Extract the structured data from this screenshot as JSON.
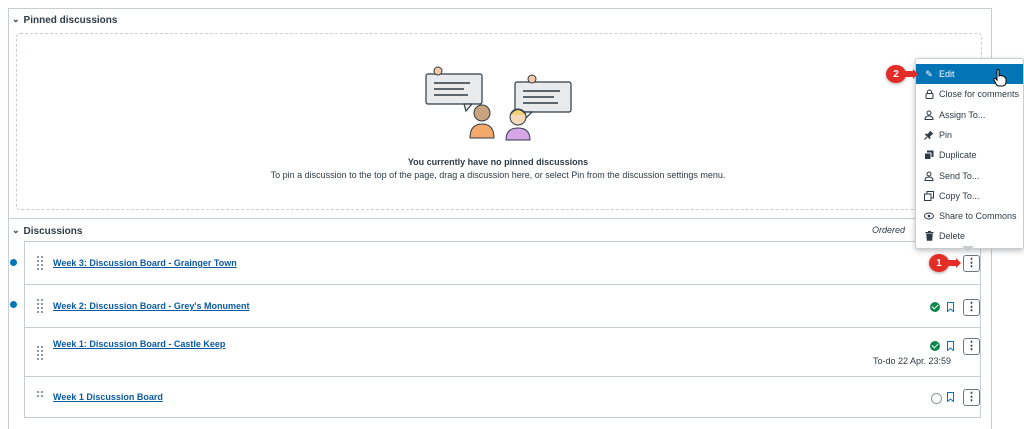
{
  "pinned": {
    "heading": "Pinned discussions",
    "empty_title": "You currently have no pinned discussions",
    "empty_sub": "To pin a discussion to the top of the page, drag a discussion here, or select Pin from the discussion settings menu."
  },
  "discussions": {
    "heading": "Discussions",
    "ordered_label": "Ordered",
    "rows": [
      {
        "title": "Week 3: Discussion Board - Grainger Town",
        "unread": true
      },
      {
        "title": "Week 2: Discussion Board - Grey's Monument",
        "unread": true,
        "published": true
      },
      {
        "title": "Week 1: Discussion Board - Castle Keep",
        "unread": false,
        "published": true,
        "todo": "To-do 22 Apr. 23:59"
      },
      {
        "title": "Week 1 Discussion Board",
        "unread": false
      }
    ]
  },
  "menu": {
    "items": [
      {
        "label": "Edit",
        "icon": "pencil-icon"
      },
      {
        "label": "Close for comments",
        "icon": "lock-icon"
      },
      {
        "label": "Assign To...",
        "icon": "assign-icon"
      },
      {
        "label": "Pin",
        "icon": "pin-icon"
      },
      {
        "label": "Duplicate",
        "icon": "duplicate-icon"
      },
      {
        "label": "Send To...",
        "icon": "send-icon"
      },
      {
        "label": "Copy To...",
        "icon": "copy-icon"
      },
      {
        "label": "Share to Commons",
        "icon": "commons-icon"
      },
      {
        "label": "Delete",
        "icon": "trash-icon"
      }
    ],
    "active": "Edit"
  },
  "annotations": {
    "step1": "1",
    "step2": "2"
  },
  "colors": {
    "link": "#0b5aa2",
    "accent": "#0374b5",
    "published": "#0b874b",
    "badge": "#e52d27"
  }
}
